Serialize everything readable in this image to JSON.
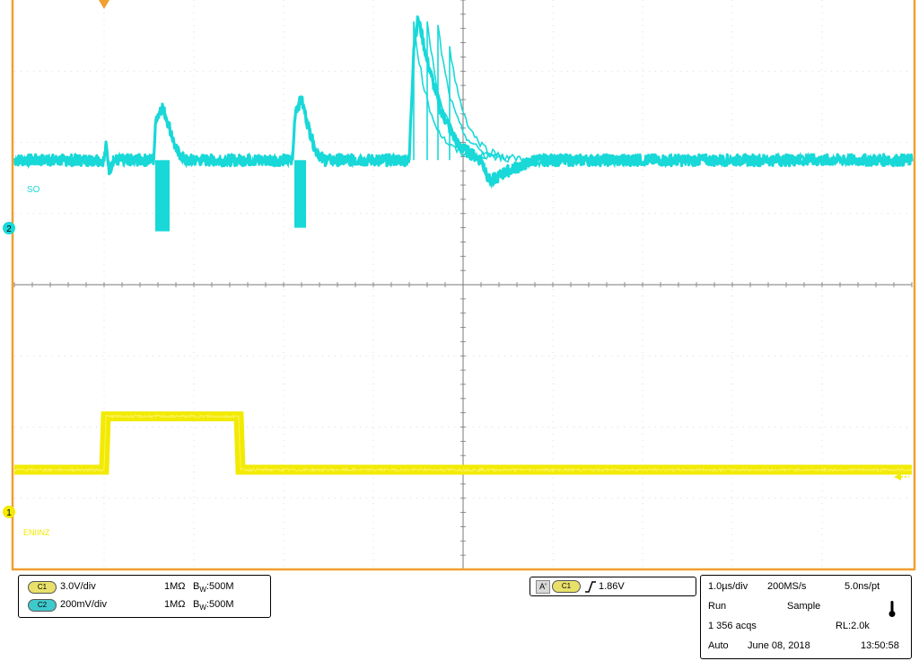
{
  "colors": {
    "ch1": "#f2ea00",
    "ch2": "#19d8d8",
    "frame": "#f0a030",
    "grid": "#7a7a7a"
  },
  "chart_data": {
    "type": "line",
    "title": "",
    "grid": true,
    "divisions": {
      "x": 10,
      "y": 8
    },
    "x": {
      "label": "",
      "units": "µs",
      "range": [
        -1.0,
        9.0
      ]
    },
    "series": [
      {
        "name": "SO",
        "channel": "C2",
        "color": "#19d8d8",
        "marker_label": "2",
        "v_per_div": "200mV/div",
        "baseline_div": 1.75,
        "noise_div": 0.08,
        "points": [
          [
            -1.0,
            0.0
          ],
          [
            0.0,
            0.0
          ],
          [
            0.02,
            0.2
          ],
          [
            0.06,
            -0.15
          ],
          [
            0.1,
            0.0
          ],
          [
            0.55,
            0.0
          ],
          [
            0.58,
            0.6
          ],
          [
            0.65,
            0.75
          ],
          [
            0.72,
            0.5
          ],
          [
            0.8,
            0.15
          ],
          [
            0.9,
            0.0
          ],
          [
            2.1,
            0.0
          ],
          [
            2.13,
            0.7
          ],
          [
            2.2,
            0.85
          ],
          [
            2.27,
            0.5
          ],
          [
            2.35,
            0.15
          ],
          [
            2.45,
            0.0
          ],
          [
            3.4,
            0.0
          ],
          [
            3.45,
            1.6
          ],
          [
            3.5,
            2.0
          ],
          [
            3.6,
            1.4
          ],
          [
            3.75,
            0.7
          ],
          [
            3.95,
            0.2
          ],
          [
            4.2,
            0.0
          ],
          [
            4.3,
            -0.3
          ],
          [
            4.5,
            -0.15
          ],
          [
            4.8,
            0.0
          ],
          [
            9.0,
            0.0
          ]
        ],
        "bursts": [
          {
            "t0": 0.55,
            "t1": 0.75,
            "low_div": -1.0
          },
          {
            "t0": 2.1,
            "t1": 2.27,
            "low_div": -0.95
          }
        ],
        "decay_traces": [
          {
            "t": 3.45,
            "peak_div": 1.95
          },
          {
            "t": 3.6,
            "peak_div": 1.95
          },
          {
            "t": 3.72,
            "peak_div": 1.9
          },
          {
            "t": 3.85,
            "peak_div": 1.6
          }
        ]
      },
      {
        "name": "ENIINZ",
        "channel": "C1",
        "color": "#f2ea00",
        "marker_label": "1",
        "v_per_div": "3.0V/div",
        "baseline_div": -2.6,
        "points": [
          [
            -1.0,
            0.0
          ],
          [
            0.0,
            0.0
          ],
          [
            0.02,
            0.75
          ],
          [
            1.5,
            0.75
          ],
          [
            1.52,
            0.0
          ],
          [
            9.0,
            0.0
          ]
        ]
      }
    ],
    "trigger": {
      "channel": "C1",
      "slope": "rising",
      "level": "1.86V",
      "position_us": 0.0
    }
  },
  "channels": [
    {
      "badge": "C1",
      "scale": "3.0V/div",
      "impedance": "1MΩ",
      "bw_prefix": "B",
      "bw_sub": "W",
      "bw_value": ":500M"
    },
    {
      "badge": "C2",
      "scale": "200mV/div",
      "impedance": "1MΩ",
      "bw_prefix": "B",
      "bw_sub": "W",
      "bw_value": ":500M"
    }
  ],
  "trigger_panel": {
    "source_badge": "A'",
    "channel_badge": "C1",
    "level": "1.86V"
  },
  "acquisition": {
    "timebase": "1.0µs/div",
    "sample_rate": "200MS/s",
    "resolution": "5.0ns/pt",
    "state": "Run",
    "mode": "Sample",
    "acqs": "1 356 acqs",
    "record_length": "RL:2.0k",
    "trigger_mode": "Auto",
    "date": "June 08, 2018",
    "time": "13:50:58"
  }
}
